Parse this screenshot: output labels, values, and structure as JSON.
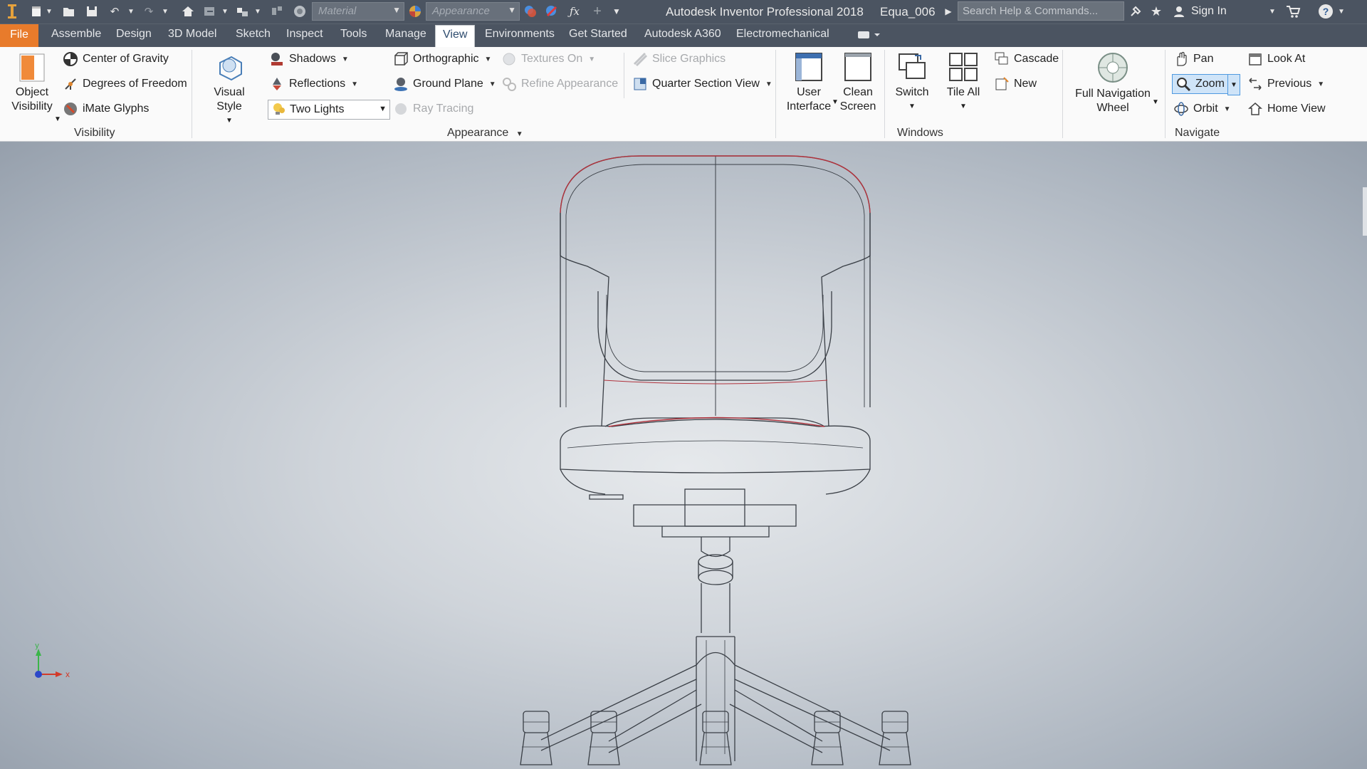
{
  "titlebar": {
    "material_placeholder": "Material",
    "appearance_placeholder": "Appearance",
    "app_title": "Autodesk Inventor Professional 2018",
    "document": "Equa_006",
    "search_placeholder": "Search Help & Commands...",
    "sign_in": "Sign In",
    "icons": [
      "inventor-logo-icon",
      "new-icon",
      "open-icon",
      "save-icon",
      "undo-icon",
      "redo-icon",
      "home-icon",
      "update-icon",
      "measure-icon",
      "color-wheel-icon",
      "clear-override-icon",
      "fx-icon",
      "plus-icon",
      "customize-icon",
      "star-icon",
      "user-icon",
      "cart-icon",
      "help-icon"
    ]
  },
  "tabs": [
    {
      "label": "File"
    },
    {
      "label": "Assemble"
    },
    {
      "label": "Design"
    },
    {
      "label": "3D Model"
    },
    {
      "label": "Sketch"
    },
    {
      "label": "Inspect"
    },
    {
      "label": "Tools"
    },
    {
      "label": "Manage"
    },
    {
      "label": "View",
      "active": true
    },
    {
      "label": "Environments"
    },
    {
      "label": "Get Started"
    },
    {
      "label": "Autodesk A360"
    },
    {
      "label": "Electromechanical"
    }
  ],
  "ribbon": {
    "visibility": {
      "title": "Visibility",
      "object_visibility": [
        "Object",
        "Visibility"
      ],
      "center_of_gravity": "Center of Gravity",
      "degrees_of_freedom": "Degrees of Freedom",
      "imate_glyphs": "iMate Glyphs"
    },
    "appearance": {
      "title": "Appearance",
      "visual_style": "Visual Style",
      "shadows": "Shadows",
      "reflections": "Reflections",
      "lighting_value": "Two Lights",
      "orthographic": "Orthographic",
      "ground_plane": "Ground Plane",
      "ray_tracing": "Ray Tracing",
      "textures_on": "Textures On",
      "refine_appearance": "Refine Appearance",
      "slice_graphics": "Slice Graphics",
      "quarter_section_view": "Quarter Section View"
    },
    "windows": {
      "title": "Windows",
      "user_interface": [
        "User",
        "Interface"
      ],
      "clean_screen": [
        "Clean",
        "Screen"
      ],
      "switch": "Switch",
      "tile_all": "Tile All",
      "cascade": "Cascade",
      "new": "New"
    },
    "navigate": {
      "title": "Navigate",
      "full_navigation_wheel": [
        "Full Navigation",
        "Wheel"
      ],
      "pan": "Pan",
      "zoom": "Zoom",
      "orbit": "Orbit",
      "look_at": "Look At",
      "previous": "Previous",
      "home_view": "Home View"
    }
  },
  "viewport": {
    "axis_x": "x",
    "axis_y": "y",
    "colors": {
      "wire": "#3a3f46",
      "edge_red": "#b0323c",
      "axis_x": "#d23a2a",
      "axis_y": "#3bb54a",
      "axis_z": "#2b47c9"
    }
  }
}
